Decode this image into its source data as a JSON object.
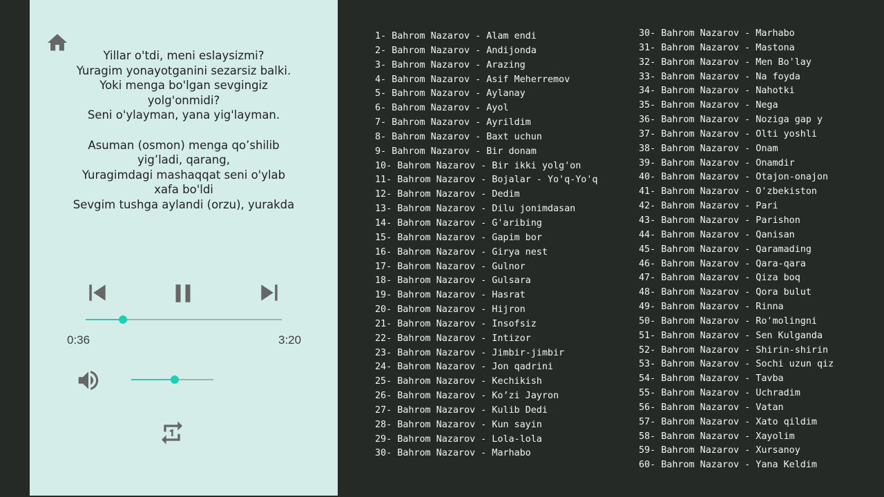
{
  "player": {
    "lyrics": [
      "Yillar o'tdi, meni eslaysizmi?",
      "Yuragim yonayotganini sezarsiz balki.",
      "Yoki menga bo'lgan sevgingiz",
      "yolg'onmidi?",
      "Seni o'ylayman, yana yig'layman.",
      "",
      "Asuman (osmon) menga qo’shilib",
      "yig’ladi, qarang,",
      "Yuragimdagi mashaqqat seni o'ylab",
      "xafa bo'ldi",
      "Sevgim tushga aylandi (orzu), yurakda"
    ],
    "elapsed": "0:36",
    "duration": "3:20",
    "progress_fraction": 0.19,
    "volume_fraction": 0.53,
    "icons": {
      "home": "home-icon",
      "previous": "skip-previous-icon",
      "pause": "pause-icon",
      "next": "skip-next-icon",
      "volume": "volume-up-icon",
      "repeat": "repeat-one-icon"
    },
    "colors": {
      "accent": "#1ecfb8",
      "panel": "#d4ede8",
      "icon": "#666666"
    }
  },
  "playlist": {
    "column1": [
      "1- Bahrom Nazarov - Alam endi",
      "2- Bahrom Nazarov - Andijonda",
      "3- Bahrom Nazarov - Arazing",
      "4- Bahrom Nazarov - Asif Meherremov",
      "5- Bahrom Nazarov - Aylanay",
      "6- Bahrom Nazarov - Ayol",
      "7- Bahrom Nazarov - Ayrildim",
      "8- Bahrom Nazarov - Baxt uchun",
      "9- Bahrom Nazarov - Bir donam",
      "10- Bahrom Nazarov - Bir ikki yolg'on",
      "11- Bahrom Nazarov - Bojalar - Yo'q-Yo'q",
      "12- Bahrom Nazarov - Dedim",
      "13- Bahrom Nazarov - Dilu jonimdasan",
      "14- Bahrom Nazarov - G'aribing",
      "15- Bahrom Nazarov - Gapim bor",
      "16- Bahrom Nazarov - Girya nest",
      "17- Bahrom Nazarov - Gulnor",
      "18- Bahrom Nazarov - Gulsara",
      "19- Bahrom Nazarov - Hasrat",
      "20- Bahrom Nazarov - Hijron",
      "21- Bahrom Nazarov - Insofsiz",
      "22- Bahrom Nazarov - Intizor",
      "23- Bahrom Nazarov - Jimbir-jimbir",
      "24- Bahrom Nazarov - Jon qadrini",
      "25- Bahrom Nazarov - Kechikish",
      "26- Bahrom Nazarov - Ko’zi Jayron",
      "27- Bahrom Nazarov - Kulib Dedi",
      "28- Bahrom Nazarov - Kun sayin",
      "29- Bahrom Nazarov - Lola-lola",
      "30- Bahrom Nazarov - Marhabo"
    ],
    "column2": [
      "30- Bahrom Nazarov - Marhabo",
      "31- Bahrom Nazarov - Mastona",
      "32- Bahrom Nazarov - Men Bo'lay",
      "33- Bahrom Nazarov - Na foyda",
      "34- Bahrom Nazarov - Nahotki",
      "35- Bahrom Nazarov - Nega",
      "36- Bahrom Nazarov - Noziga gap y",
      "37- Bahrom Nazarov - Olti yoshli",
      "38- Bahrom Nazarov - Onam",
      "39- Bahrom Nazarov - Onamdir",
      "40- Bahrom Nazarov - Otajon-onajon",
      "41- Bahrom Nazarov - O'zbekiston",
      "42- Bahrom Nazarov - Pari",
      "43- Bahrom Nazarov - Parishon",
      "44- Bahrom Nazarov - Qanisan",
      "45- Bahrom Nazarov - Qaramading",
      "46- Bahrom Nazarov - Qara-qara",
      "47- Bahrom Nazarov - Qiza boq",
      "48- Bahrom Nazarov - Qora bulut",
      "49- Bahrom Nazarov - Rinna",
      "50- Bahrom Nazarov - Ro'molingni",
      "51- Bahrom Nazarov - Sen Kulganda",
      "52- Bahrom Nazarov - Shirin-shirin",
      "53- Bahrom Nazarov - Sochi uzun qiz",
      "54- Bahrom Nazarov - Tavba",
      "55- Bahrom Nazarov - Uchradim",
      "56- Bahrom Nazarov - Vatan",
      "57- Bahrom Nazarov - Xato qildim",
      "58- Bahrom Nazarov - Xayolim",
      "59- Bahrom Nazarov - Xursanoy",
      "60- Bahrom Nazarov - Yana Keldim"
    ]
  }
}
